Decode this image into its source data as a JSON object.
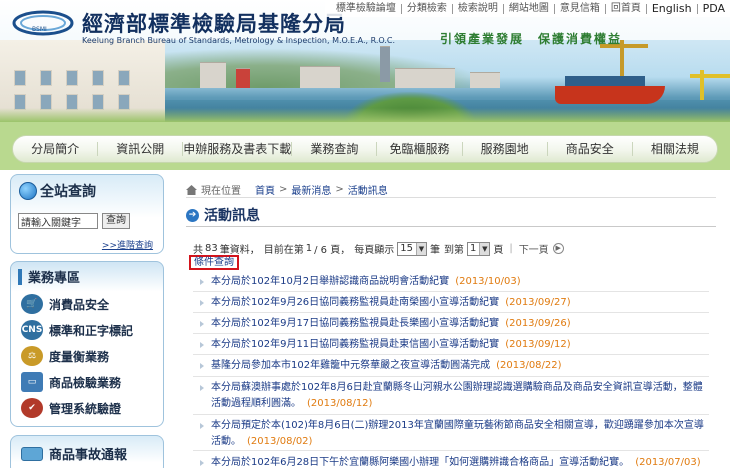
{
  "header": {
    "title": "經濟部標準檢驗局基隆分局",
    "subtitle": "Keelung Branch Bureau of Standards, Metrology & Inspection, M.O.E.A., R.O.C.",
    "slogan": "引領產業發展　保護消費權益",
    "logo_text": "BSMI",
    "top_links": [
      "標準檢驗論壇",
      "分類檢索",
      "檢索說明",
      "網站地圖",
      "意見信箱",
      "回首頁",
      "English",
      "PDA"
    ]
  },
  "nav": {
    "items": [
      "分局簡介",
      "資訊公開",
      "申辦服務及書表下載",
      "業務查詢",
      "免臨櫃服務",
      "服務園地",
      "商品安全",
      "相關法規"
    ]
  },
  "sidebar": {
    "search": {
      "title": "全站查詢",
      "placeholder": "請輸入關鍵字",
      "button": "查詢",
      "advanced": ">>進階查詢"
    },
    "business": {
      "title": "業務專區",
      "items": [
        {
          "label": "消費品安全",
          "icon": "shopping-cart-icon",
          "color": "#2f6fa0"
        },
        {
          "label": "標準和正字標記",
          "icon": "cns-icon",
          "color": "#2f6fa0"
        },
        {
          "label": "度量衡業務",
          "icon": "scale-icon",
          "color": "#c99a28"
        },
        {
          "label": "商品檢驗業務",
          "icon": "monitor-icon",
          "color": "#3f7bb5"
        },
        {
          "label": "管理系統驗證",
          "icon": "certificate-icon",
          "color": "#b23a2a"
        }
      ]
    },
    "news": {
      "title": "商品事故通報"
    }
  },
  "breadcrumb": {
    "label": "現在位置",
    "items": [
      "首頁",
      "最新消息",
      "活動訊息"
    ]
  },
  "page": {
    "heading": "活動訊息"
  },
  "pager": {
    "total_prefix": "共",
    "total": "83",
    "total_suffix": "筆資料，",
    "current_prefix": "目前在第",
    "current": "1",
    "pages_suffix": "/ 6 頁，",
    "per_page_label": "每頁顯示",
    "per_page": "15",
    "per_page_suffix": "筆",
    "goto_label": "到第",
    "goto": "1",
    "goto_suffix": "頁",
    "next": "下一頁"
  },
  "condition_query": "條件查詢",
  "list": [
    {
      "title": "本分局於102年10月2日舉辦認識商品說明會活動紀實",
      "date": "(2013/10/03)"
    },
    {
      "title": "本分局於102年9月26日協同義務監視員赴南榮國小宣導活動紀實",
      "date": "(2013/09/27)"
    },
    {
      "title": "本分局於102年9月17日協同義務監視員赴長樂國小宣導活動紀實",
      "date": "(2013/09/26)"
    },
    {
      "title": "本分局於102年9月11日協同義務監視員赴東信國小宣導活動紀實",
      "date": "(2013/09/12)"
    },
    {
      "title": "基隆分局參加本市102年雞籠中元祭華嚴之夜宣導活動圓滿完成",
      "date": "(2013/08/22)"
    },
    {
      "title": "本分局蘇澳辦事處於102年8月6日赴宜蘭縣冬山河親水公園辦理認識選購驗商品及商品安全資訊宣導活動，整體活動過程順利圓滿。",
      "date": "(2013/08/12)"
    },
    {
      "title": "本分局預定於本(102)年8月6日(二)辦理2013年宜蘭國際童玩藝術節商品安全相關宣導，歡迎踴躍參加本次宣導活動。",
      "date": "(2013/08/02)"
    },
    {
      "title": "本分局於102年6月28日下午於宜蘭縣阿樂國小辦理「如何選購辨識合格商品」宣導活動紀實。",
      "date": "(2013/07/03)"
    }
  ]
}
